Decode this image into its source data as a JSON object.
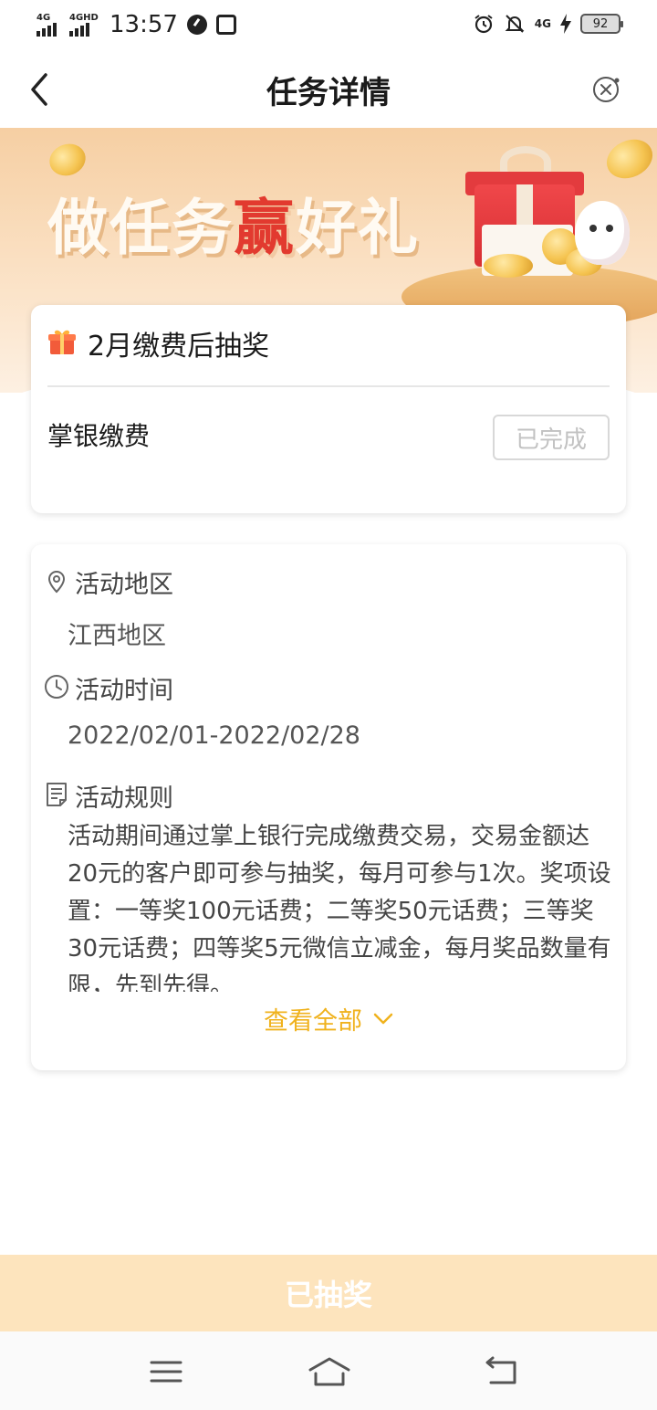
{
  "status_bar": {
    "signal1": "4G",
    "signal2": "4GHD",
    "time": "13:57",
    "network": "4G",
    "battery": "92"
  },
  "nav": {
    "title": "任务详情"
  },
  "banner": {
    "slogan_part1": "做任务",
    "slogan_win": "赢",
    "slogan_part2": "好礼"
  },
  "task": {
    "title": "2月缴费后抽奖",
    "name": "掌银缴费",
    "status": "已完成"
  },
  "activity": {
    "region_label": "活动地区",
    "region_value": "江西地区",
    "time_label": "活动时间",
    "time_value": "2022/02/01-2022/02/28",
    "rules_label": "活动规则",
    "rules_text": "活动期间通过掌上银行完成缴费交易，交易金额达20元的客户即可参与抽奖，每月可参与1次。奖项设置：一等奖100元话费；二等奖50元话费；三等奖30元话费；四等奖5元微信立减金，每月奖品数量有限，先到先得。",
    "view_all": "查看全部"
  },
  "bottom_button": {
    "label": "已抽奖"
  },
  "colors": {
    "accent": "#f0b21d",
    "bottom_button_bg": "#fde4bd",
    "banner_bg": "#f6cfa3",
    "win_red": "#e23a2f"
  },
  "icons": [
    "back-icon",
    "close-icon",
    "gift-icon",
    "location-icon",
    "clock-icon",
    "document-icon",
    "chevron-down-icon",
    "menu-icon",
    "home-icon",
    "return-icon"
  ]
}
